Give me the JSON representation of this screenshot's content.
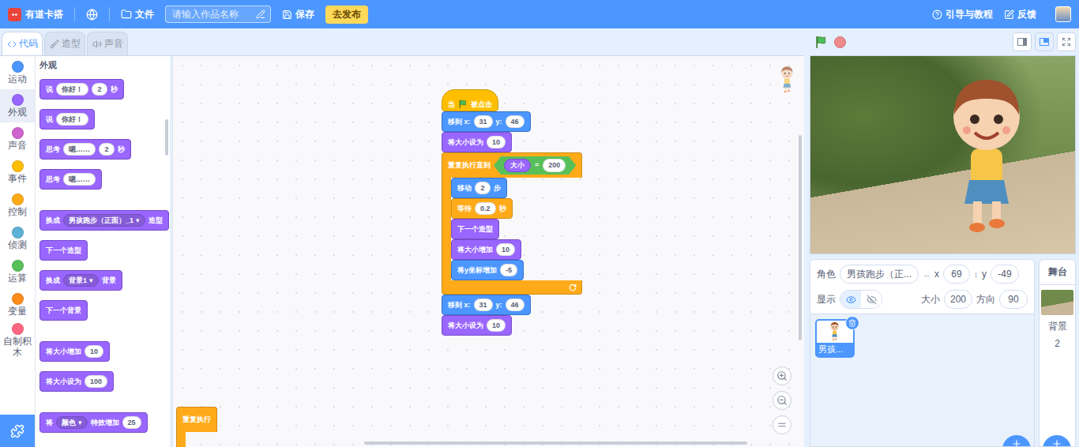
{
  "topbar": {
    "logo": "有道卡搭",
    "file_menu": "文件",
    "title_input": {
      "placeholder": "请输入作品名称"
    },
    "save": "保存",
    "publish": "去发布",
    "help": "引导与教程",
    "feedback": "反馈"
  },
  "tabs": [
    {
      "label": "代码",
      "selected": true
    },
    {
      "label": "造型",
      "selected": false
    },
    {
      "label": "声音",
      "selected": false
    }
  ],
  "categories": [
    {
      "label": "运动",
      "color": "#4c97ff",
      "selected": false
    },
    {
      "label": "外观",
      "color": "#9966ff",
      "selected": true
    },
    {
      "label": "声音",
      "color": "#cf63cf",
      "selected": false
    },
    {
      "label": "事件",
      "color": "#ffbf00",
      "selected": false
    },
    {
      "label": "控制",
      "color": "#ffab19",
      "selected": false
    },
    {
      "label": "侦测",
      "color": "#5cb1d6",
      "selected": false
    },
    {
      "label": "运算",
      "color": "#59c059",
      "selected": false
    },
    {
      "label": "变量",
      "color": "#ff8c1a",
      "selected": false
    },
    {
      "label": "自制积木",
      "color": "#ff6680",
      "selected": false
    }
  ],
  "palette": {
    "heading": "外观",
    "groups": [
      [
        {
          "kind": "looks",
          "parts": [
            {
              "kind": "text",
              "text": "说"
            },
            {
              "kind": "input",
              "text": "你好！"
            },
            {
              "kind": "input",
              "text": "2"
            },
            {
              "kind": "text",
              "text": "秒"
            }
          ]
        },
        {
          "kind": "looks",
          "parts": [
            {
              "kind": "text",
              "text": "说"
            },
            {
              "kind": "input",
              "text": "你好！"
            }
          ]
        },
        {
          "kind": "looks",
          "parts": [
            {
              "kind": "text",
              "text": "思考"
            },
            {
              "kind": "input",
              "text": "嗯……"
            },
            {
              "kind": "input",
              "text": "2"
            },
            {
              "kind": "text",
              "text": "秒"
            }
          ]
        },
        {
          "kind": "looks",
          "parts": [
            {
              "kind": "text",
              "text": "思考"
            },
            {
              "kind": "input",
              "text": "嗯……"
            }
          ]
        }
      ],
      [
        {
          "kind": "looks",
          "parts": [
            {
              "kind": "text",
              "text": "换成"
            },
            {
              "kind": "dropdown",
              "text": "男孩跑步（正面）_1",
              "arrow": "▾"
            },
            {
              "kind": "text",
              "text": "造型"
            }
          ]
        },
        {
          "kind": "looks",
          "parts": [
            {
              "kind": "text",
              "text": "下一个造型"
            }
          ]
        },
        {
          "kind": "looks",
          "parts": [
            {
              "kind": "text",
              "text": "换成"
            },
            {
              "kind": "dropdown",
              "text": "背景1",
              "arrow": "▾"
            },
            {
              "kind": "text",
              "text": "背景"
            }
          ]
        },
        {
          "kind": "looks",
          "parts": [
            {
              "kind": "text",
              "text": "下一个背景"
            }
          ]
        }
      ],
      [
        {
          "kind": "looks",
          "parts": [
            {
              "kind": "text",
              "text": "将大小增加"
            },
            {
              "kind": "input",
              "text": "10"
            }
          ]
        },
        {
          "kind": "looks",
          "parts": [
            {
              "kind": "text",
              "text": "将大小设为"
            },
            {
              "kind": "input",
              "text": "100"
            }
          ]
        }
      ],
      [
        {
          "kind": "looks",
          "parts": [
            {
              "kind": "text",
              "text": "将"
            },
            {
              "kind": "dropdown",
              "text": "颜色",
              "arrow": "▾"
            },
            {
              "kind": "text",
              "text": "特效增加"
            },
            {
              "kind": "input",
              "text": "25"
            }
          ]
        }
      ]
    ]
  },
  "script": [
    {
      "kind": "events",
      "shape": "hat",
      "parts": [
        {
          "kind": "text",
          "text": "当"
        },
        {
          "kind": "flag"
        },
        {
          "kind": "text",
          "text": "被点击"
        }
      ]
    },
    {
      "kind": "motion",
      "shape": "stack",
      "parts": [
        {
          "kind": "text",
          "text": "移到 x:"
        },
        {
          "kind": "input",
          "text": "31"
        },
        {
          "kind": "text",
          "text": "y:"
        },
        {
          "kind": "input",
          "text": "46"
        }
      ]
    },
    {
      "kind": "looks",
      "shape": "stack",
      "parts": [
        {
          "kind": "text",
          "text": "将大小设为"
        },
        {
          "kind": "input",
          "text": "10"
        }
      ]
    },
    {
      "kind": "control",
      "shape": "c",
      "parts": [
        {
          "kind": "text",
          "text": "重复执行直到"
        },
        {
          "kind": "bool",
          "parts": [
            {
              "kind": "reporter",
              "text": "大小"
            },
            {
              "kind": "text",
              "text": "="
            },
            {
              "kind": "input",
              "text": "200"
            }
          ]
        }
      ],
      "body": [
        {
          "kind": "motion",
          "shape": "stack",
          "parts": [
            {
              "kind": "text",
              "text": "移动"
            },
            {
              "kind": "input",
              "text": "2"
            },
            {
              "kind": "text",
              "text": "步"
            }
          ]
        },
        {
          "kind": "control",
          "shape": "stack",
          "parts": [
            {
              "kind": "text",
              "text": "等待"
            },
            {
              "kind": "input",
              "text": "0.2"
            },
            {
              "kind": "text",
              "text": "秒"
            }
          ]
        },
        {
          "kind": "looks",
          "shape": "stack",
          "parts": [
            {
              "kind": "text",
              "text": "下一个造型"
            }
          ]
        },
        {
          "kind": "looks",
          "shape": "stack",
          "parts": [
            {
              "kind": "text",
              "text": "将大小增加"
            },
            {
              "kind": "input",
              "text": "10"
            }
          ]
        },
        {
          "kind": "motion",
          "shape": "stack",
          "parts": [
            {
              "kind": "text",
              "text": "将y坐标增加"
            },
            {
              "kind": "input",
              "text": "-5"
            }
          ]
        }
      ]
    },
    {
      "kind": "motion",
      "shape": "stack",
      "parts": [
        {
          "kind": "text",
          "text": "移到 x:"
        },
        {
          "kind": "input",
          "text": "31"
        },
        {
          "kind": "text",
          "text": "y:"
        },
        {
          "kind": "input",
          "text": "46"
        }
      ]
    },
    {
      "kind": "looks",
      "shape": "stack",
      "parts": [
        {
          "kind": "text",
          "text": "将大小设为"
        },
        {
          "kind": "input",
          "text": "10"
        }
      ]
    }
  ],
  "loose_block": {
    "kind": "control",
    "shape": "c",
    "parts": [
      {
        "kind": "text",
        "text": "重复执行"
      }
    ],
    "body": []
  },
  "sprite_info": {
    "label": "角色",
    "name": "男孩跑步（正...",
    "x_icon": "↔",
    "x_label": "x",
    "x": "69",
    "y_icon": "↕",
    "y_label": "y",
    "y": "-49",
    "show_label": "显示",
    "visible": true,
    "size_label": "大小",
    "size": "200",
    "direction_label": "方向",
    "direction": "90"
  },
  "sprite_list": [
    {
      "name": "男孩...",
      "selected": true
    }
  ],
  "stage_panel": {
    "title": "舞台",
    "backdrop_label": "背景",
    "backdrop_count": "2"
  }
}
